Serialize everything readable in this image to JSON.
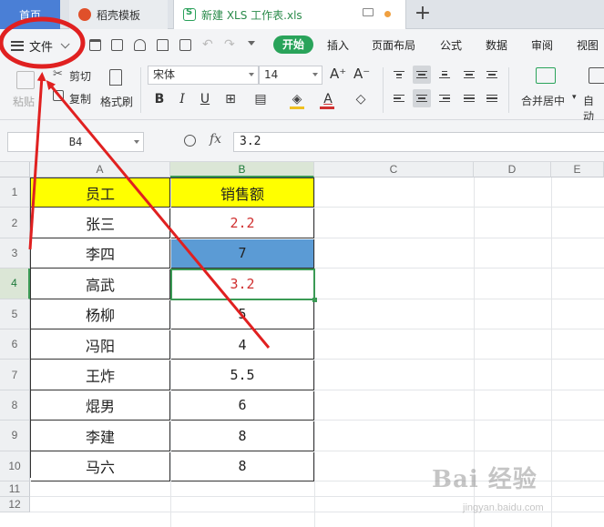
{
  "tabs": {
    "home": "首页",
    "templates": "稻壳模板",
    "document": "新建 XLS 工作表.xls",
    "add": "+"
  },
  "menu": {
    "file": "文件",
    "items": [
      "开始",
      "插入",
      "页面布局",
      "公式",
      "数据",
      "审阅",
      "视图"
    ]
  },
  "ribbon": {
    "paste": "粘贴",
    "cut": "剪切",
    "copy": "复制",
    "format_painter": "格式刷",
    "font_name": "宋体",
    "font_size": "14",
    "grow_font": "A⁺",
    "shrink_font": "A⁻",
    "bold": "B",
    "italic": "I",
    "underline": "U",
    "merge_center": "合并居中",
    "auto_wrap": "自动"
  },
  "formula_bar": {
    "cell_ref": "B4",
    "fx": "fx",
    "value": "3.2"
  },
  "grid": {
    "columns": [
      "A",
      "B",
      "C",
      "D",
      "E"
    ],
    "rows": [
      "1",
      "2",
      "3",
      "4",
      "5",
      "6",
      "7",
      "8",
      "9",
      "10",
      "11",
      "12"
    ],
    "selected_cell": "B4"
  },
  "table": {
    "header": [
      "员工",
      "销售额"
    ],
    "rows": [
      {
        "name": "张三",
        "sales": "2.2"
      },
      {
        "name": "李四",
        "sales": "7"
      },
      {
        "name": "高武",
        "sales": "3.2"
      },
      {
        "name": "杨柳",
        "sales": "5"
      },
      {
        "name": "冯阳",
        "sales": "4"
      },
      {
        "name": "王炸",
        "sales": "5.5"
      },
      {
        "name": "焜男",
        "sales": "6"
      },
      {
        "name": "李建",
        "sales": "8"
      },
      {
        "name": "马六",
        "sales": "8"
      }
    ]
  },
  "colors": {
    "accent_green": "#29a35a",
    "header_fill": "#ffff00",
    "highlight_fill": "#5b9bd5",
    "red_text": "#d03030",
    "annotation_red": "#e02020"
  },
  "watermark": {
    "logo": "Bai 经验",
    "url": "jingyan.baidu.com"
  }
}
